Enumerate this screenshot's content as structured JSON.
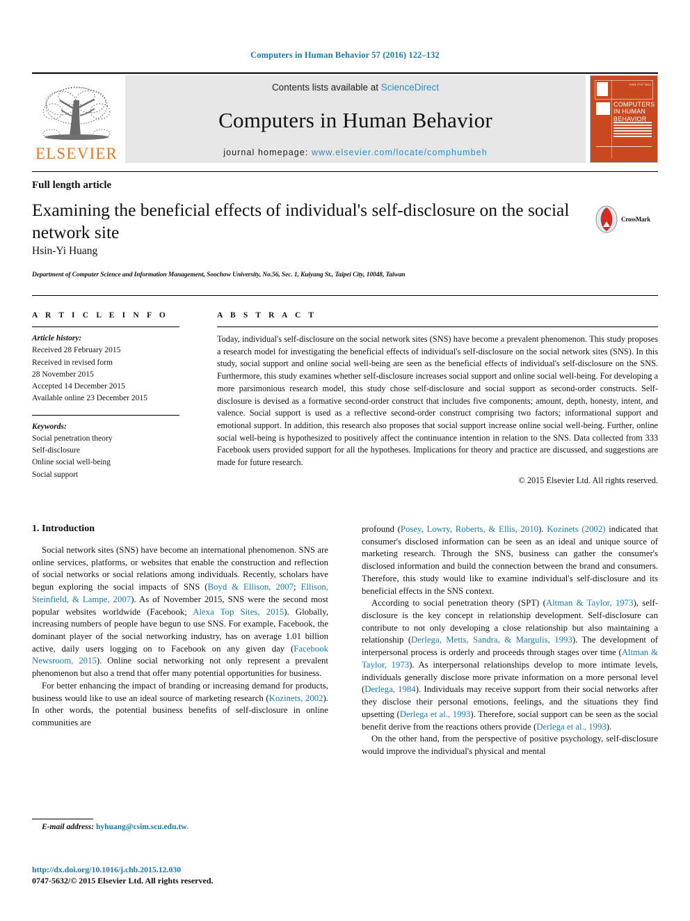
{
  "running_head": "Computers in Human Behavior 57 (2016) 122–132",
  "masthead": {
    "publisher_name": "ELSEVIER",
    "contents_prefix": "Contents lists available at ",
    "contents_link": "ScienceDirect",
    "journal_title": "Computers in Human Behavior",
    "homepage_prefix": "journal homepage: ",
    "homepage_url": "www.elsevier.com/locate/comphumbeh",
    "cover": {
      "title": "COMPUTERS IN HUMAN BEHAVIOR",
      "issn_note": "ISSN 0747-5632"
    }
  },
  "article": {
    "type": "Full length article",
    "title": "Examining the beneficial effects of individual's self-disclosure on the social network site",
    "crossmark_label": "CrossMark",
    "authors": "Hsin-Yi Huang",
    "affiliation": "Department of Computer Science and Information Management, Soochow University, No.56, Sec. 1, Kuiyang St., Taipei City, 10048, Taiwan"
  },
  "article_info": {
    "heading": "A R T I C L E   I N F O",
    "history_label": "Article history:",
    "history": [
      "Received 28 February 2015",
      "Received in revised form",
      "28 November 2015",
      "Accepted 14 December 2015",
      "Available online 23 December 2015"
    ],
    "keywords_label": "Keywords:",
    "keywords": [
      "Social penetration theory",
      "Self-disclosure",
      "Online social well-being",
      "Social support"
    ]
  },
  "abstract": {
    "heading": "A B S T R A C T",
    "text": "Today, individual's self-disclosure on the social network sites (SNS) have become a prevalent phenomenon. This study proposes a research model for investigating the beneficial effects of individual's self-disclosure on the social network sites (SNS). In this study, social support and online social well-being are seen as the beneficial effects of individual's self-disclosure on the SNS. Furthermore, this study examines whether self-disclosure increases social support and online social well-being. For developing a more parsimonious research model, this study chose self-disclosure and social support as second-order constructs. Self-disclosure is devised as a formative second-order construct that includes five components; amount, depth, honesty, intent, and valence. Social support is used as a reflective second-order construct comprising two factors; informational support and emotional support. In addition, this research also proposes that social support increase online social well-being. Further, online social well-being is hypothesized to positively affect the continuance intention in relation to the SNS. Data collected from 333 Facebook users provided support for all the hypotheses. Implications for theory and practice are discussed, and suggestions are made for future research.",
    "copyright": "© 2015 Elsevier Ltd. All rights reserved."
  },
  "body": {
    "section_heading": "1. Introduction",
    "left_paragraphs": [
      "Social network sites (SNS) have become an international phenomenon. SNS are online services, platforms, or websites that enable the construction and reflection of social networks or social relations among individuals. Recently, scholars have begun exploring the social impacts of SNS (Boyd & Ellison, 2007; Ellison, Steinfield, & Lampe, 2007). As of November 2015, SNS were the second most popular websites worldwide (Facebook; Alexa Top Sites, 2015). Globally, increasing numbers of people have begun to use SNS. For example, Facebook, the dominant player of the social networking industry, has on average 1.01 billion active, daily users logging on to Facebook on any given day (Facebook Newsroom, 2015). Online social networking not only represent a prevalent phenomenon but also a trend that offer many potential opportunities for business.",
      "For better enhancing the impact of branding or increasing demand for products, business would like to use an ideal source of marketing research (Kozinets, 2002). In other words, the potential business benefits of self-disclosure in online communities are"
    ],
    "right_paragraphs": [
      "profound (Posey, Lowry, Roberts, & Ellis, 2010). Kozinets (2002) indicated that consumer's disclosed information can be seen as an ideal and unique source of marketing research. Through the SNS, business can gather the consumer's disclosed information and build the connection between the brand and consumers. Therefore, this study would like to examine individual's self-disclosure and its beneficial effects in the SNS context.",
      "According to social penetration theory (SPT) (Altman & Taylor, 1973), self-disclosure is the key concept in relationship development. Self-disclosure can contribute to not only developing a close relationship but also maintaining a relationship (Derlega, Metts, Sandra, & Margulis, 1993). The development of interpersonal process is orderly and proceeds through stages over time (Altman & Taylor, 1973). As interpersonal relationships develop to more intimate levels, individuals generally disclose more private information on a more personal level (Derlega, 1984). Individuals may receive support from their social networks after they disclose their personal emotions, feelings, and the situations they find upsetting (Derlega et al., 1993). Therefore, social support can be seen as the social benefit derive from the reactions others provide (Derlega et al., 1993).",
      "On the other hand, from the perspective of positive psychology, self-disclosure would improve the individual's physical and mental"
    ],
    "citations": [
      "Boyd & Ellison, 2007",
      "Ellison, Steinfield, & Lampe, 2007",
      "Alexa Top Sites, 2015",
      "Facebook Newsroom, 2015",
      "Kozinets, 2002",
      "Posey, Lowry, Roberts, & Ellis, 2010",
      "Kozinets (2002)",
      "Altman & Taylor, 1973",
      "Derlega, Metts, Sandra, & Margulis, 1993",
      "Derlega, 1984",
      "Derlega et al., 1993"
    ]
  },
  "footer": {
    "email_label": "E-mail address:",
    "email": "hyhuang@csim.scu.edu.tw",
    "doi_url": "http://dx.doi.org/10.1016/j.chb.2015.12.030",
    "issn_line": "0747-5632/© 2015 Elsevier Ltd. All rights reserved."
  },
  "colors": {
    "link_blue": "#1a7ba8",
    "sciencedirect_blue": "#2b8fc4",
    "elsevier_orange": "#e87722",
    "cover_orange": "#c8491f",
    "band_gray": "#e6e6e6"
  }
}
